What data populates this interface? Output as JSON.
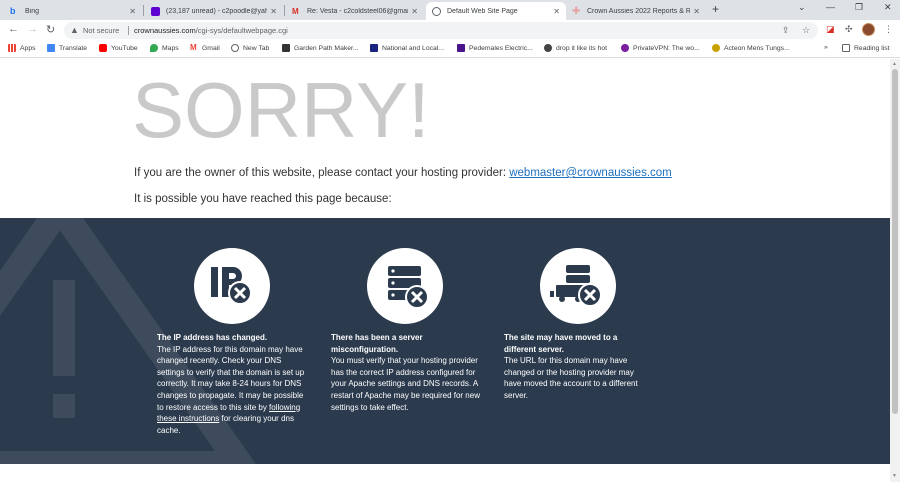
{
  "browser": {
    "tabs": [
      {
        "label": "Bing",
        "color": "#1a73e8"
      },
      {
        "label": "(23,187 unread) - c2poodle@yah",
        "color": "#6001d2"
      },
      {
        "label": "Re: Vesta - c2coldsteel06@gmai",
        "color": "#d93025"
      },
      {
        "label": "Default Web Site Page",
        "color": "#5f6368"
      },
      {
        "label": "Crown Aussies 2022 Reports & R",
        "color": "#e8a0a0"
      }
    ],
    "new_tab": "+",
    "window_controls": {
      "caret": "⌄",
      "minimize": "—",
      "restore": "❐",
      "close": "✕"
    },
    "nav": {
      "back": "←",
      "forward": "→",
      "reload": "↻"
    },
    "security_label": "Not secure",
    "url_domain": "crownaussies.com",
    "url_path": "/cgi-sys/defaultwebpage.cgi",
    "bookmarks": [
      {
        "label": "Apps",
        "color": "#5f6368"
      },
      {
        "label": "Translate",
        "color": "#4285f4"
      },
      {
        "label": "YouTube",
        "color": "#ff0000"
      },
      {
        "label": "Maps",
        "color": "#34a853"
      },
      {
        "label": "Gmail",
        "color": "#ea4335"
      },
      {
        "label": "New Tab",
        "color": "#5f6368"
      },
      {
        "label": "Garden Path Maker...",
        "color": "#333333"
      },
      {
        "label": "National and Local...",
        "color": "#1a237e"
      },
      {
        "label": "Pedemales Electric...",
        "color": "#4a148c"
      },
      {
        "label": "drop it like its hot",
        "color": "#444444"
      },
      {
        "label": "PrivateVPN: The wo...",
        "color": "#7b1fa2"
      },
      {
        "label": "Acteon Mens Tungs...",
        "color": "#c8a200"
      }
    ],
    "more_bookmarks": "»",
    "reading_list": "Reading list"
  },
  "page": {
    "headline": "SORRY!",
    "owner_text": "If you are the owner of this website, please contact your hosting provider: ",
    "owner_email": "webmaster@crownaussies.com",
    "possible_text": "It is possible you have reached this page because:",
    "reasons": [
      {
        "title": "The IP address has changed.",
        "body": "The IP address for this domain may have changed recently. Check your DNS settings to verify that the domain is set up correctly. It may take 8-24 hours for DNS changes to propagate. It may be possible to restore access to this site by ",
        "link": "following these instructions",
        "tail": " for clearing your dns cache."
      },
      {
        "title": "There has been a server misconfiguration.",
        "body": "You must verify that your hosting provider has the correct IP address configured for your Apache settings and DNS records. A restart of Apache may be required for new settings to take effect."
      },
      {
        "title": "The site may have moved to a different server.",
        "body": "The URL for this domain may have changed or the hosting provider may have moved the account to a different server."
      }
    ]
  }
}
